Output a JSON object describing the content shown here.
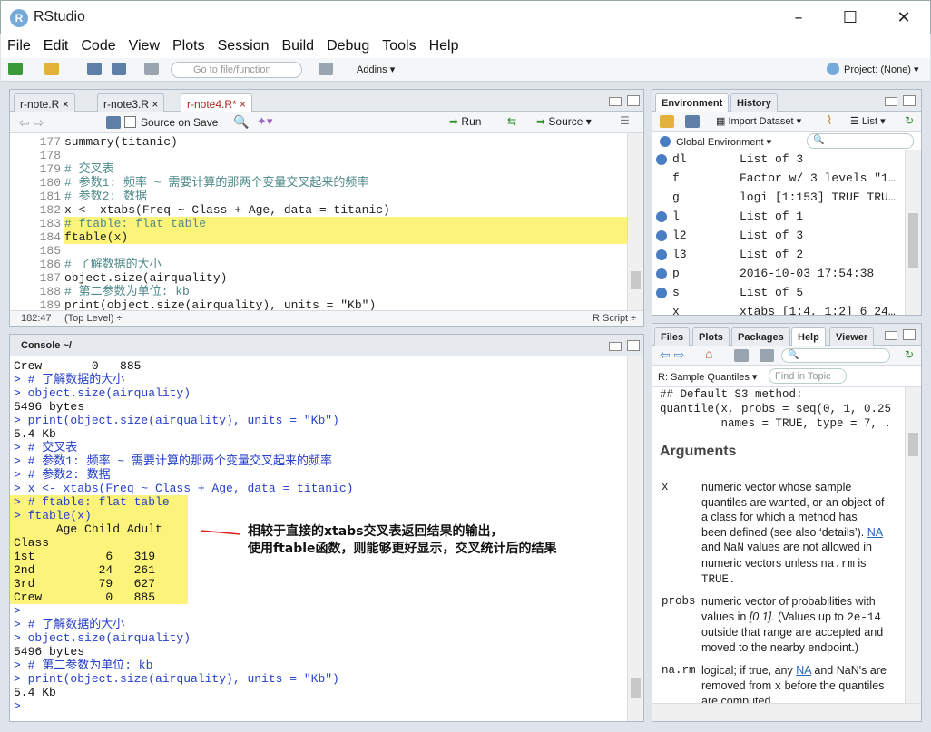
{
  "window": {
    "title": "RStudio",
    "logo": "R"
  },
  "menu": [
    "File",
    "Edit",
    "Code",
    "View",
    "Plots",
    "Session",
    "Build",
    "Debug",
    "Tools",
    "Help"
  ],
  "toolbar": {
    "goto_placeholder": "Go to file/function",
    "addins": "Addins ▾",
    "project": "Project: (None) ▾"
  },
  "editor": {
    "tabs": [
      "r-note.R",
      "r-note3.R",
      "r-note4.R*"
    ],
    "source_on_save": "Source on Save",
    "run": "Run",
    "source": "Source",
    "lines": [
      {
        "n": "177",
        "t": "summary(titanic)",
        "k": "code"
      },
      {
        "n": "178",
        "t": "",
        "k": "code"
      },
      {
        "n": "179",
        "t": "# 交叉表",
        "k": "comment"
      },
      {
        "n": "180",
        "t": "# 参数1: 频率 ~ 需要计算的那两个变量交叉起来的频率",
        "k": "comment"
      },
      {
        "n": "181",
        "t": "# 参数2: 数据",
        "k": "comment"
      },
      {
        "n": "182",
        "t": "x <- xtabs(Freq ~ Class + Age, data = titanic)",
        "k": "code"
      },
      {
        "n": "183",
        "t": "# ftable: flat table",
        "k": "comment-hl"
      },
      {
        "n": "184",
        "t": "ftable(x)",
        "k": "code-hl"
      },
      {
        "n": "185",
        "t": "",
        "k": "code"
      },
      {
        "n": "186",
        "t": "# 了解数据的大小",
        "k": "comment"
      },
      {
        "n": "187",
        "t": "object.size(airquality)",
        "k": "code"
      },
      {
        "n": "188",
        "t": "# 第二参数为单位: kb",
        "k": "comment"
      },
      {
        "n": "189",
        "t": "print(object.size(airquality), units = \"Kb\")",
        "k": "code"
      }
    ],
    "status_pos": "182:47",
    "status_scope": "(Top Level) ÷",
    "status_type": "R Script ÷"
  },
  "console": {
    "title": "Console ~/",
    "lines": [
      {
        "t": "Crew       0   885",
        "k": "out"
      },
      {
        "t": "> # 了解数据的大小",
        "k": "in"
      },
      {
        "t": "> object.size(airquality)",
        "k": "in"
      },
      {
        "t": "5496 bytes",
        "k": "out"
      },
      {
        "t": "> print(object.size(airquality), units = \"Kb\")",
        "k": "in"
      },
      {
        "t": "5.4 Kb",
        "k": "out"
      },
      {
        "t": "> # 交叉表",
        "k": "in"
      },
      {
        "t": "> # 参数1: 频率 ~ 需要计算的那两个变量交叉起来的频率",
        "k": "in"
      },
      {
        "t": "> # 参数2: 数据",
        "k": "in"
      },
      {
        "t": "> x <- xtabs(Freq ~ Class + Age, data = titanic)",
        "k": "in"
      },
      {
        "t": "> # ftable: flat table",
        "k": "in-hl"
      },
      {
        "t": "> ftable(x)",
        "k": "in-hl"
      },
      {
        "t": "      Age Child Adult",
        "k": "out-hl"
      },
      {
        "t": "Class                ",
        "k": "out-hl"
      },
      {
        "t": "1st          6   319",
        "k": "out-hl"
      },
      {
        "t": "2nd         24   261",
        "k": "out-hl"
      },
      {
        "t": "3rd         79   627",
        "k": "out-hl"
      },
      {
        "t": "Crew         0   885",
        "k": "out-hl"
      },
      {
        "t": ">",
        "k": "in"
      },
      {
        "t": "> # 了解数据的大小",
        "k": "in"
      },
      {
        "t": "> object.size(airquality)",
        "k": "in"
      },
      {
        "t": "5496 bytes",
        "k": "out"
      },
      {
        "t": "> # 第二参数为单位: kb",
        "k": "in"
      },
      {
        "t": "> print(object.size(airquality), units = \"Kb\")",
        "k": "in"
      },
      {
        "t": "5.4 Kb",
        "k": "out"
      },
      {
        "t": ">",
        "k": "in"
      }
    ],
    "annotation": [
      "相较于直接的xtabs交叉表返回结果的输出，",
      "使用ftable函数，则能够更好显示，交叉统计后的结果"
    ]
  },
  "env": {
    "tabs": [
      "Environment",
      "History"
    ],
    "import": "Import Dataset ▾",
    "list": "List ▾",
    "scope": "Global Environment ▾",
    "rows": [
      {
        "n": "dl",
        "v": "List of 3",
        "dot": true
      },
      {
        "n": "f",
        "v": "Factor w/ 3 levels \"1…",
        "dot": false
      },
      {
        "n": "g",
        "v": "logi [1:153] TRUE TRU…",
        "dot": false
      },
      {
        "n": "l",
        "v": "List of 1",
        "dot": true
      },
      {
        "n": "l2",
        "v": "List of 3",
        "dot": true
      },
      {
        "n": "l3",
        "v": "List of 2",
        "dot": true
      },
      {
        "n": "p",
        "v": "2016-10-03 17:54:38",
        "dot": true
      },
      {
        "n": "s",
        "v": "List of 5",
        "dot": true
      },
      {
        "n": "x",
        "v": "xtabs [1:4, 1:2] 6 24…",
        "dot": false
      }
    ]
  },
  "help": {
    "tabs": [
      "Files",
      "Plots",
      "Packages",
      "Help",
      "Viewer"
    ],
    "topic": "R: Sample Quantiles ▾",
    "find_placeholder": "Find in Topic",
    "code1": "## Default S3 method:",
    "code2": "quantile(x, probs = seq(0, 1, 0.25",
    "code3": "         names = TRUE, type = 7, .",
    "heading": "Arguments",
    "x_name": "x",
    "probs_name": "probs",
    "narm_name": "na.rm",
    "x_desc": [
      "numeric vector whose sample",
      "quantiles are wanted, or an object of",
      "a class for which a method has",
      "been defined (see also ‘details’).",
      "and",
      "values are not allowed in",
      "numeric vectors unless",
      "is",
      "TRUE."
    ],
    "na": "NA",
    "nan": "NaN",
    "narm_code": "na.rm",
    "probs_desc": [
      "numeric vector of probabilities with",
      "values in",
      "(Values up to",
      "outside that range are accepted and",
      "moved to the nearby endpoint.)"
    ],
    "probs_range": "[0,1].",
    "probs_tol": "2e-14",
    "narm_desc": [
      "logical; if true, any",
      "and NaN's are",
      "removed from",
      "before the quantiles",
      "are computed."
    ],
    "narm_x": "x"
  }
}
